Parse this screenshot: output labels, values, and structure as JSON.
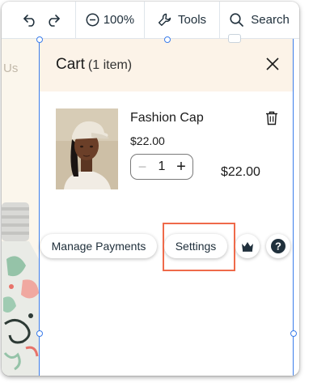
{
  "toolbar": {
    "undo_icon": "undo-icon",
    "redo_icon": "redo-icon",
    "zoom_icon": "zoom-out-icon",
    "zoom_label": "100%",
    "tools_icon": "wrench-icon",
    "tools_label": "Tools",
    "search_icon": "search-icon",
    "search_label": "Search"
  },
  "canvas": {
    "partial_text": "Us"
  },
  "cart": {
    "title": "Cart",
    "count": "(1 item)",
    "close_icon": "close-icon",
    "item": {
      "name": "Fashion Cap",
      "price": "$22.00",
      "quantity": "1",
      "minus": "−",
      "plus": "+",
      "total": "$22.00",
      "delete_icon": "trash-icon"
    }
  },
  "actions": {
    "manage_payments": "Manage Payments",
    "settings": "Settings",
    "crown_icon": "crown-icon",
    "help_icon": "help-icon"
  },
  "colors": {
    "accent_selection": "#3b7dea",
    "highlight": "#ef6a4a",
    "cart_header_bg": "#fcf3e8"
  }
}
